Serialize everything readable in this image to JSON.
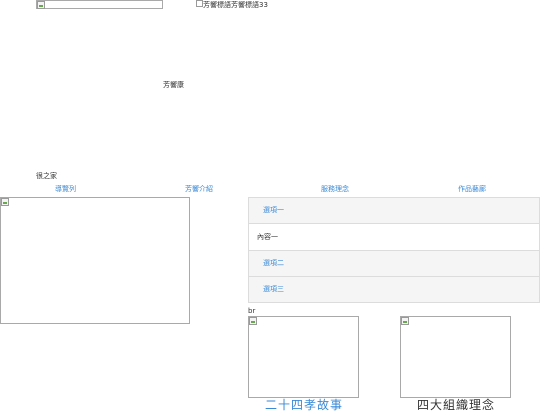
{
  "header": {
    "logo_alt": "",
    "banner_alt": "芳響標語芳響標語33",
    "brand_text": "芳響康"
  },
  "breadcrumb": "很之家",
  "nav": {
    "items": [
      "導覽列",
      "芳響介紹",
      "服務理念",
      "作品藝廊"
    ]
  },
  "accordion": {
    "items": [
      {
        "label": "選項一",
        "content": "內容一"
      },
      {
        "label": "選項二"
      },
      {
        "label": "選項三"
      }
    ]
  },
  "br_text": "br",
  "cards": [
    {
      "caption": "二十四孝故事"
    },
    {
      "caption": "四大組織理念"
    }
  ]
}
